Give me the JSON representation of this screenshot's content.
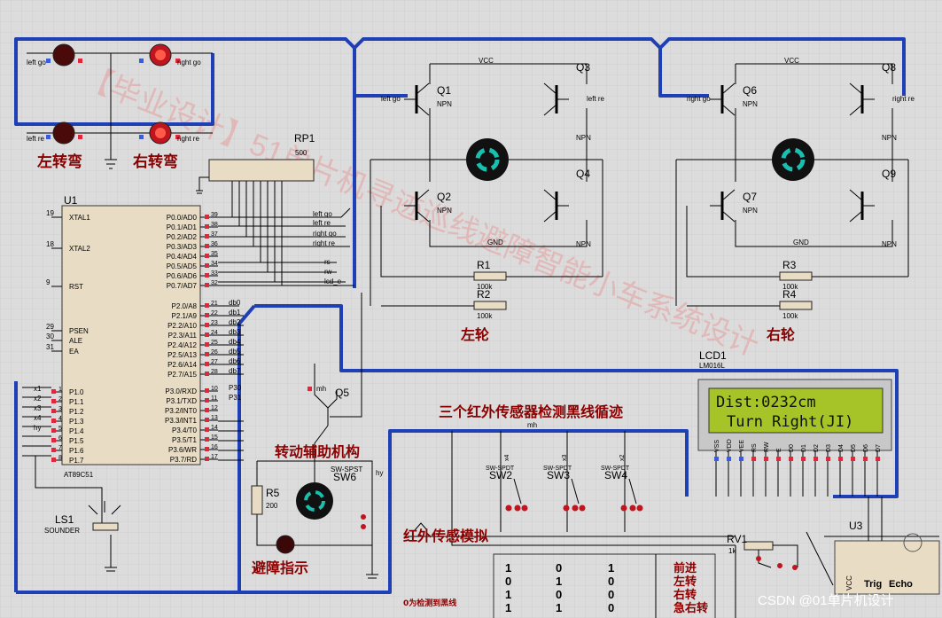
{
  "chip": {
    "ref": "U1",
    "part": "AT89C51",
    "left_pins": [
      {
        "n": "19",
        "name": "XTAL1"
      },
      {
        "n": "18",
        "name": "XTAL2"
      },
      {
        "n": "9",
        "name": "RST"
      },
      {
        "n": "29",
        "name": "PSEN"
      },
      {
        "n": "30",
        "name": "ALE"
      },
      {
        "n": "31",
        "name": "EA"
      }
    ],
    "p1_pins": [
      {
        "n": "1",
        "name": "P1.0"
      },
      {
        "n": "2",
        "name": "P1.1"
      },
      {
        "n": "3",
        "name": "P1.2"
      },
      {
        "n": "4",
        "name": "P1.3"
      },
      {
        "n": "5",
        "name": "P1.4"
      },
      {
        "n": "6",
        "name": "P1.5"
      },
      {
        "n": "7",
        "name": "P1.6"
      },
      {
        "n": "8",
        "name": "P1.7"
      }
    ],
    "p1_nets": [
      "x1",
      "x2",
      "x3",
      "x4",
      "hy",
      "",
      "",
      ""
    ],
    "p0_pins": [
      {
        "n": "39",
        "name": "P0.0/AD0"
      },
      {
        "n": "38",
        "name": "P0.1/AD1"
      },
      {
        "n": "37",
        "name": "P0.2/AD2"
      },
      {
        "n": "36",
        "name": "P0.3/AD3"
      },
      {
        "n": "35",
        "name": "P0.4/AD4"
      },
      {
        "n": "34",
        "name": "P0.5/AD5"
      },
      {
        "n": "33",
        "name": "P0.6/AD6"
      },
      {
        "n": "32",
        "name": "P0.7/AD7"
      }
    ],
    "p2_pins": [
      {
        "n": "21",
        "name": "P2.0/A8"
      },
      {
        "n": "22",
        "name": "P2.1/A9"
      },
      {
        "n": "23",
        "name": "P2.2/A10"
      },
      {
        "n": "24",
        "name": "P2.3/A11"
      },
      {
        "n": "25",
        "name": "P2.4/A12"
      },
      {
        "n": "26",
        "name": "P2.5/A13"
      },
      {
        "n": "27",
        "name": "P2.6/A14"
      },
      {
        "n": "28",
        "name": "P2.7/A15"
      }
    ],
    "p2_nets": [
      "db0",
      "db1",
      "db2",
      "db3",
      "db4",
      "db5",
      "db6",
      "db7"
    ],
    "p3_pins": [
      {
        "n": "10",
        "name": "P3.0/RXD"
      },
      {
        "n": "11",
        "name": "P3.1/TXD"
      },
      {
        "n": "12",
        "name": "P3.2/INT0"
      },
      {
        "n": "13",
        "name": "P3.3/INT1"
      },
      {
        "n": "14",
        "name": "P3.4/T0"
      },
      {
        "n": "15",
        "name": "P3.5/T1"
      },
      {
        "n": "16",
        "name": "P3.6/WR"
      },
      {
        "n": "17",
        "name": "P3.7/RD"
      }
    ],
    "p3_nets": [
      "P30",
      "P31",
      "",
      "",
      "",
      "",
      "",
      ""
    ]
  },
  "rp1": {
    "ref": "RP1",
    "value": "500"
  },
  "p0_nets": [
    "left go",
    "left re",
    "right go",
    "right re",
    "rs",
    "rw",
    "lcd_e"
  ],
  "leds": {
    "left_go": "left go",
    "right_go": "right go",
    "left_re": "left re",
    "right_re": "right re",
    "cap_left": "左转弯",
    "cap_right": "右转弯"
  },
  "bridge_left": {
    "q_top_left": "Q1",
    "q_top_right": "Q3",
    "q_bot_left": "Q2",
    "q_bot_right": "Q4",
    "npn": "NPN",
    "vcc": "VCC",
    "gnd": "GND",
    "in_go": "left go",
    "in_re": "left re",
    "r1": "R1",
    "r2": "R2",
    "rval": "100k",
    "caption": "左轮"
  },
  "bridge_right": {
    "q_top_left": "Q6",
    "q_top_right": "Q8",
    "q_bot_left": "Q7",
    "q_bot_right": "Q9",
    "npn": "NPN",
    "vcc": "VCC",
    "gnd": "GND",
    "in_go": "right go",
    "in_re": "right re",
    "r1": "R3",
    "r2": "R4",
    "rval": "100k",
    "caption": "右轮"
  },
  "lcd": {
    "ref": "LCD1",
    "part": "LM016L",
    "line1": "Dist:0232cm",
    "line2": "Turn Right(JI)",
    "pins": [
      "VSS",
      "VDD",
      "VEE",
      "RS",
      "RW",
      "E",
      "D0",
      "D1",
      "D2",
      "D3",
      "D4",
      "D5",
      "D6",
      "D7"
    ]
  },
  "q5": {
    "ref": "Q5",
    "label": "mh",
    "caption": "转动辅助机构"
  },
  "r5": {
    "ref": "R5",
    "value": "200"
  },
  "sw6": {
    "ref": "SW6",
    "part": "SW-SPST",
    "net": "hy"
  },
  "sensors": {
    "title": "三个红外传感器检测黑线循迹",
    "net": "mh",
    "sw": [
      {
        "ref": "SW2",
        "part": "SW-SPDT",
        "net": "x4"
      },
      {
        "ref": "SW3",
        "part": "SW-SPDT",
        "net": "x3"
      },
      {
        "ref": "SW4",
        "part": "SW-SPDT",
        "net": "x2"
      }
    ],
    "caption": "红外传感模拟"
  },
  "ls1": {
    "ref": "LS1",
    "part": "SOUNDER"
  },
  "avoid": {
    "caption": "避障指示"
  },
  "rv1": {
    "ref": "RV1",
    "value": "1k"
  },
  "u3": {
    "ref": "U3",
    "vcc": "VCC",
    "trig": "Trig",
    "echo": "Echo"
  },
  "truth": {
    "note": "0为检测到黑线",
    "rows": [
      [
        "1",
        "0",
        "1",
        "前进"
      ],
      [
        "0",
        "1",
        "0",
        "左转"
      ],
      [
        "1",
        "0",
        "0",
        "右转"
      ],
      [
        "1",
        "1",
        "0",
        "急右转"
      ]
    ]
  },
  "watermark": "【毕业设计】51单片机寻迹巡线避障智能小车系统设计",
  "credit": "CSDN @01单片机设计",
  "colors": {
    "bus": "#1f3fb5",
    "caption": "#8b0000",
    "lcd_bg": "#a6c427",
    "chip": "#e8dcc4"
  }
}
